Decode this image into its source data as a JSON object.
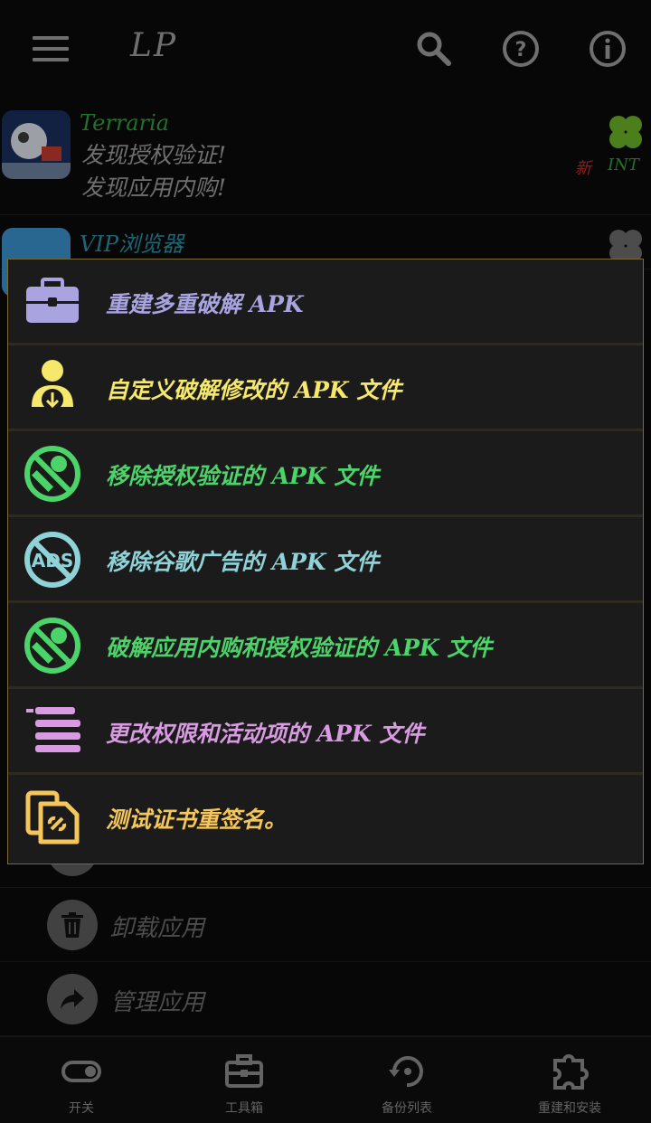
{
  "topbar": {
    "title": "LP"
  },
  "apps": [
    {
      "name": "Terraria",
      "lines": [
        "发现授权验证!",
        "发现应用内购!"
      ],
      "tag_new": "新",
      "tag_int": "INT",
      "name_color": "#2e9e3c"
    },
    {
      "name": "VIP浏览器",
      "name_color": "#2a8ea0"
    }
  ],
  "actions": [
    {
      "label": "卸载应用"
    },
    {
      "label": "管理应用"
    }
  ],
  "dialog": {
    "items": [
      {
        "label": "重建多重破解 APK",
        "color": "#a9a4e0"
      },
      {
        "label": "自定义破解修改的 APK 文件",
        "color": "#f5e86a"
      },
      {
        "label": "移除授权验证的 APK 文件",
        "color": "#4cd36a"
      },
      {
        "label": "移除谷歌广告的 APK 文件",
        "color": "#8fd3d8"
      },
      {
        "label": "破解应用内购和授权验证的 APK 文件",
        "color": "#4cd36a"
      },
      {
        "label": "更改权限和活动项的 APK 文件",
        "color": "#d89ae0"
      },
      {
        "label": "测试证书重签名。",
        "color": "#f5c65a"
      }
    ]
  },
  "bottom_nav": [
    {
      "label": "开关",
      "icon": "toggle-icon"
    },
    {
      "label": "工具箱",
      "icon": "toolbox-icon"
    },
    {
      "label": "备份列表",
      "icon": "backup-icon"
    },
    {
      "label": "重建和安装",
      "icon": "puzzle-icon"
    }
  ]
}
